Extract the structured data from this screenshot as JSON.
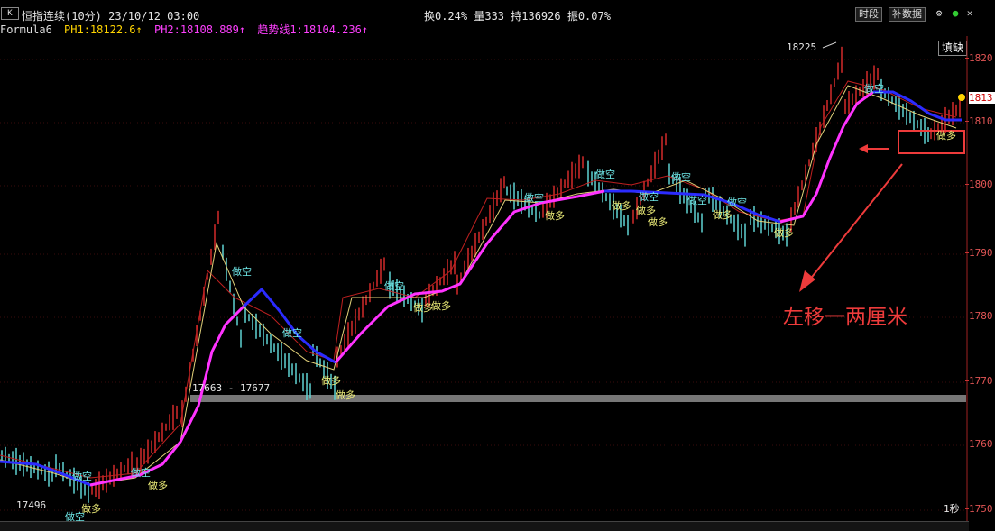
{
  "header": {
    "icon_letter": "K",
    "title": "恒指连续(10分) 23/10/12 03:00",
    "stats": "换0.24% 量333 持136926 振0.07%",
    "btn_time": "时段",
    "btn_fill": "补数据",
    "icon_names": [
      "gear-icon",
      "dot-green-icon",
      "close-icon"
    ]
  },
  "formula": {
    "name": "Formula6",
    "ph1": "PH1:18122.6↑",
    "ph2": "PH2:18108.889↑",
    "trend": "趋势线1:18104.236↑",
    "colors": {
      "name": "#dddddd",
      "ph1": "#ffd400",
      "ph2": "#ff40ff",
      "trend": "#ff40ff"
    }
  },
  "fill_button": "填缺",
  "price_axis": {
    "ticks": [
      "1820",
      "1810",
      "1800",
      "1790",
      "1780",
      "1770",
      "1760",
      "1750"
    ],
    "current": "1813"
  },
  "annotations": {
    "high": "18225",
    "low": "17496",
    "range": "17663 - 17677",
    "note": "左移一两厘米",
    "seconds": "1秒",
    "signals": [
      {
        "text": "做空",
        "kind": "short"
      },
      {
        "text": "做多",
        "kind": "long"
      },
      {
        "text": "做空",
        "kind": "short"
      },
      {
        "text": "做多",
        "kind": "long"
      },
      {
        "text": "做空",
        "kind": "short"
      },
      {
        "text": "做空",
        "kind": "short"
      },
      {
        "text": "做空",
        "kind": "short"
      },
      {
        "text": "做多",
        "kind": "long"
      },
      {
        "text": "做空",
        "kind": "short"
      },
      {
        "text": "做多",
        "kind": "long"
      },
      {
        "text": "做多",
        "kind": "long"
      },
      {
        "text": "做空",
        "kind": "short"
      },
      {
        "text": "做多",
        "kind": "long"
      },
      {
        "text": "做空",
        "kind": "short"
      },
      {
        "text": "做多",
        "kind": "long"
      },
      {
        "text": "做多",
        "kind": "long"
      },
      {
        "text": "做空",
        "kind": "short"
      },
      {
        "text": "做空",
        "kind": "short"
      },
      {
        "text": "做多",
        "kind": "long"
      },
      {
        "text": "做空",
        "kind": "short"
      },
      {
        "text": "做多",
        "kind": "long"
      },
      {
        "text": "做空",
        "kind": "short"
      },
      {
        "text": "做多",
        "kind": "long"
      },
      {
        "text": "做空",
        "kind": "short"
      },
      {
        "text": "做多",
        "kind": "long"
      },
      {
        "text": "做多",
        "kind": "long"
      }
    ]
  },
  "colors": {
    "background": "#000000",
    "up_bar": "#d42a2a",
    "down_bar": "#5fd3d3",
    "trend_up": "#ff33ff",
    "trend_down": "#2222ff",
    "note": "#ee3b3b",
    "support_band": "#777777"
  }
}
